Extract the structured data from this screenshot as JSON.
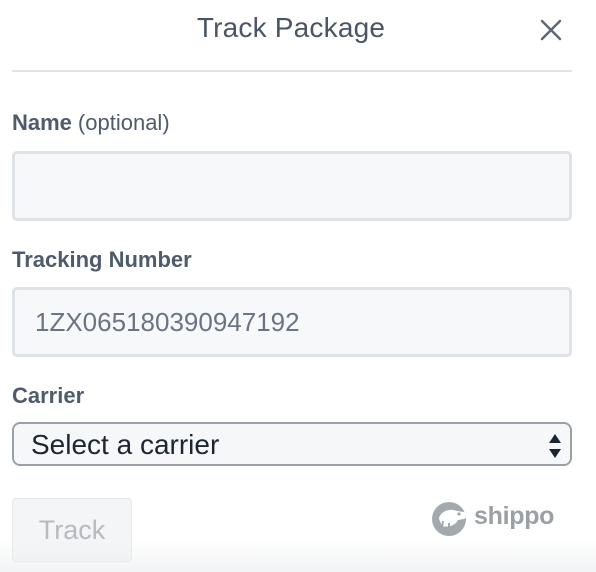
{
  "dialog": {
    "title": "Track Package",
    "close_icon": "close-icon"
  },
  "form": {
    "name_label": "Name",
    "name_optional": "(optional)",
    "name_value": "",
    "tracking_label": "Tracking Number",
    "tracking_value": "1ZX065180390947192",
    "carrier_label": "Carrier",
    "carrier_selected": "Select a carrier",
    "carrier_arrows_icon": "select-arrows-icon"
  },
  "actions": {
    "track_label": "Track"
  },
  "brand": {
    "name": "shippo",
    "logo_icon": "shippo-logo-icon"
  },
  "colors": {
    "title_text": "#4a5566",
    "label_text": "#4f5b6c",
    "input_border": "#dfe2e6",
    "input_background": "#f7f8fa",
    "button_disabled_text": "#b6bbc1",
    "brand_gray": "#9aa0a6"
  }
}
